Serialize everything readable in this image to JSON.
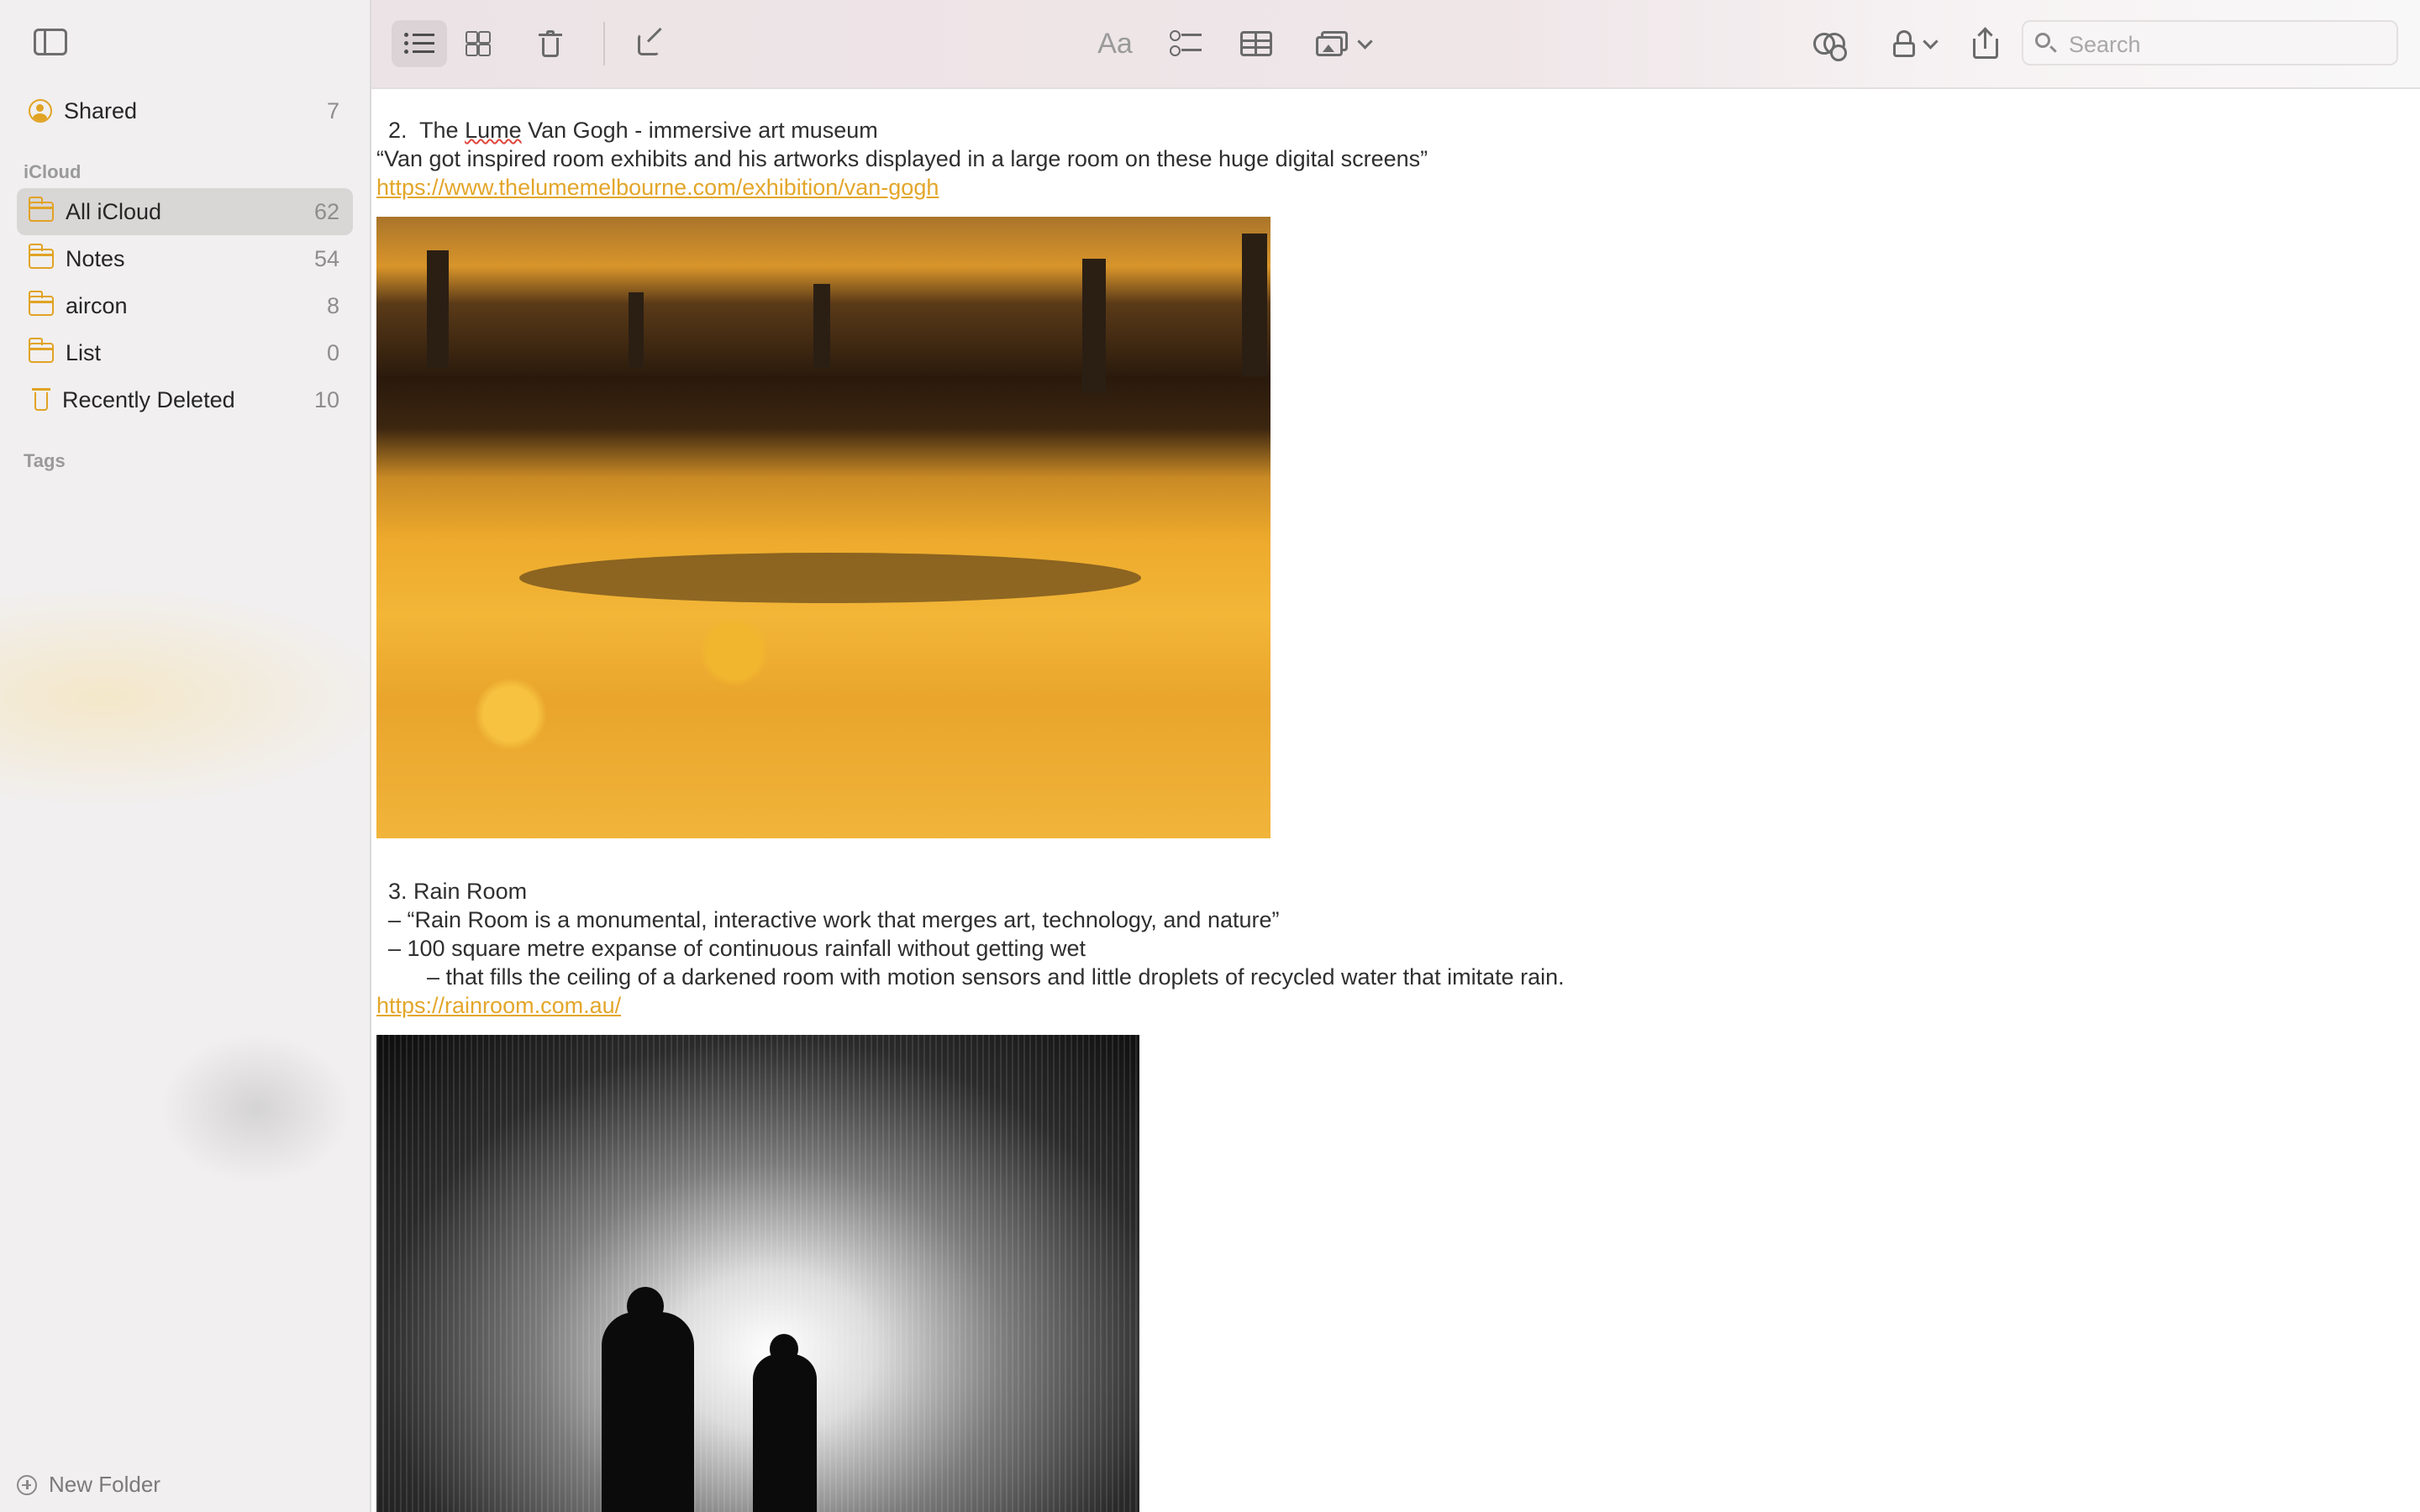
{
  "sidebar": {
    "shared": {
      "label": "Shared",
      "count": "7"
    },
    "section_icloud": "iCloud",
    "folders": [
      {
        "label": "All iCloud",
        "count": "62",
        "selected": true
      },
      {
        "label": "Notes",
        "count": "54"
      },
      {
        "label": "aircon",
        "count": "8"
      },
      {
        "label": "List",
        "count": "0"
      },
      {
        "label": "Recently Deleted",
        "count": "10"
      }
    ],
    "section_tags": "Tags",
    "new_folder": "New Folder"
  },
  "toolbar": {
    "format_label": "Aa",
    "search_placeholder": "Search"
  },
  "note": {
    "item2_title_prefix": "2.  The ",
    "item2_title_misspelled": "Lume",
    "item2_title_suffix": " Van Gogh - immersive art museum",
    "item2_quote": "“Van got inspired room exhibits and his artworks displayed in a large room on these huge digital screens”",
    "item2_link": "https://www.thelumemelbourne.com/exhibition/van-gogh",
    "item3_title": "3.  Rain Room",
    "item3_bullet1": "–  “Rain Room is a monumental, interactive work that merges art, technology, and nature”",
    "item3_bullet2": "–  100 square metre expanse of continuous rainfall without getting wet",
    "item3_subbullet": "–  that fills the ceiling of a darkened room with motion sensors and little droplets of recycled water that imitate rain.",
    "item3_link": "https://rainroom.com.au/"
  },
  "colors": {
    "accent": "#e1a324",
    "link": "#e3a62a",
    "sidebar_bg": "#f1efef",
    "selected_row": "#d9d6d6"
  },
  "icons": [
    "sidebar-toggle-icon",
    "list-view-icon",
    "gallery-view-icon",
    "trash-icon",
    "compose-icon",
    "text-format-icon",
    "checklist-icon",
    "table-icon",
    "media-icon",
    "collaborate-icon",
    "lock-icon",
    "share-icon",
    "search-icon",
    "folder-icon",
    "shared-icon",
    "plus-circle-icon"
  ]
}
